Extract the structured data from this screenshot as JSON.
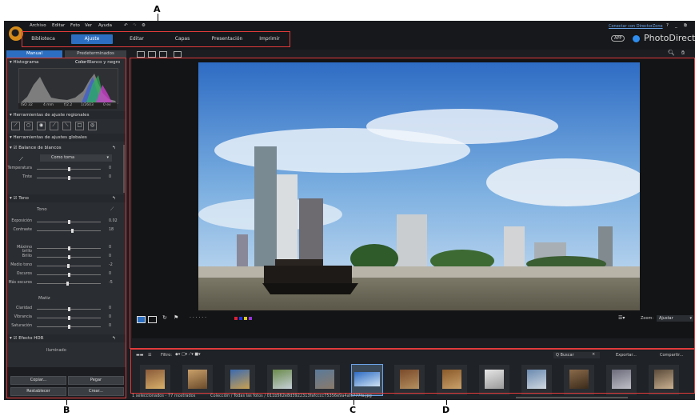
{
  "callouts": {
    "a": "A",
    "b": "B",
    "c": "C",
    "d": "D"
  },
  "menu": [
    "Archivo",
    "Editar",
    "Foto",
    "Ver",
    "Ayuda"
  ],
  "tabs": [
    "Biblioteca",
    "Ajuste",
    "Editar",
    "Capas",
    "Presentación",
    "Imprimir"
  ],
  "active_tab": "Ajuste",
  "topright": {
    "connect": "Conectar con DirectorZone",
    "app_badge": "APP",
    "brand": "PhotoDirecto"
  },
  "left_panel": {
    "mode_tabs": [
      "Manual",
      "Predeterminados"
    ],
    "histogram": {
      "title": "Histograma",
      "color_label": "Color",
      "color_value": "Blanco y negro",
      "exif": [
        "ISO 32",
        "4 mm",
        "f/2.2",
        "1/2603",
        "0 ev"
      ]
    },
    "regional_title": "Herramientas de ajuste regionales",
    "global_title": "Herramientas de ajustes globales",
    "wb": {
      "title": "Balance de blancos",
      "preset": "Como toma",
      "sliders": [
        {
          "label": "Temperatura",
          "value": "0",
          "pos": 0.5
        },
        {
          "label": "Tinte",
          "value": "0",
          "pos": 0.5
        }
      ]
    },
    "tone": {
      "title": "Tono",
      "subtitle": "Tono",
      "sliders": [
        {
          "label": "Exposición",
          "value": "0.02",
          "pos": 0.5
        },
        {
          "label": "Contraste",
          "value": "18",
          "pos": 0.56
        }
      ]
    },
    "tone2": [
      {
        "label": "Máximo brillo",
        "value": "0",
        "pos": 0.5
      },
      {
        "label": "Brillo",
        "value": "0",
        "pos": 0.5
      },
      {
        "label": "Medio tono",
        "value": "-2",
        "pos": 0.49
      },
      {
        "label": "Oscuros",
        "value": "0",
        "pos": 0.5
      },
      {
        "label": "Más oscuros",
        "value": "-5",
        "pos": 0.48
      }
    ],
    "matiz": {
      "title": "Matiz",
      "sliders": [
        {
          "label": "Claridad",
          "value": "0",
          "pos": 0.5
        },
        {
          "label": "Vibrancia",
          "value": "0",
          "pos": 0.5
        },
        {
          "label": "Saturación",
          "value": "0",
          "pos": 0.5
        }
      ]
    },
    "hdr": {
      "title": "Efecto HDR",
      "sub": "Iluminado"
    },
    "buttons": [
      "Copiar...",
      "Pegar",
      "Restablecer",
      "Crear..."
    ]
  },
  "viewer": {
    "zoom_label": "Zoom:",
    "zoom_value": "Ajustar"
  },
  "strip": {
    "filter": "Filtro:",
    "search": "Q Buscar",
    "export": "Exportar...",
    "share": "Compartir...",
    "status": "1 seleccionados - 77 mostrados",
    "path": "Colección / Todas las fotos / 011b562e8d3922313fafcccc75356e9a4afc777fa.jpg",
    "thumbs": 13,
    "selected": 5
  },
  "colors": {
    "accent": "#2c6fc2",
    "callout_box": "#e23b3b"
  }
}
